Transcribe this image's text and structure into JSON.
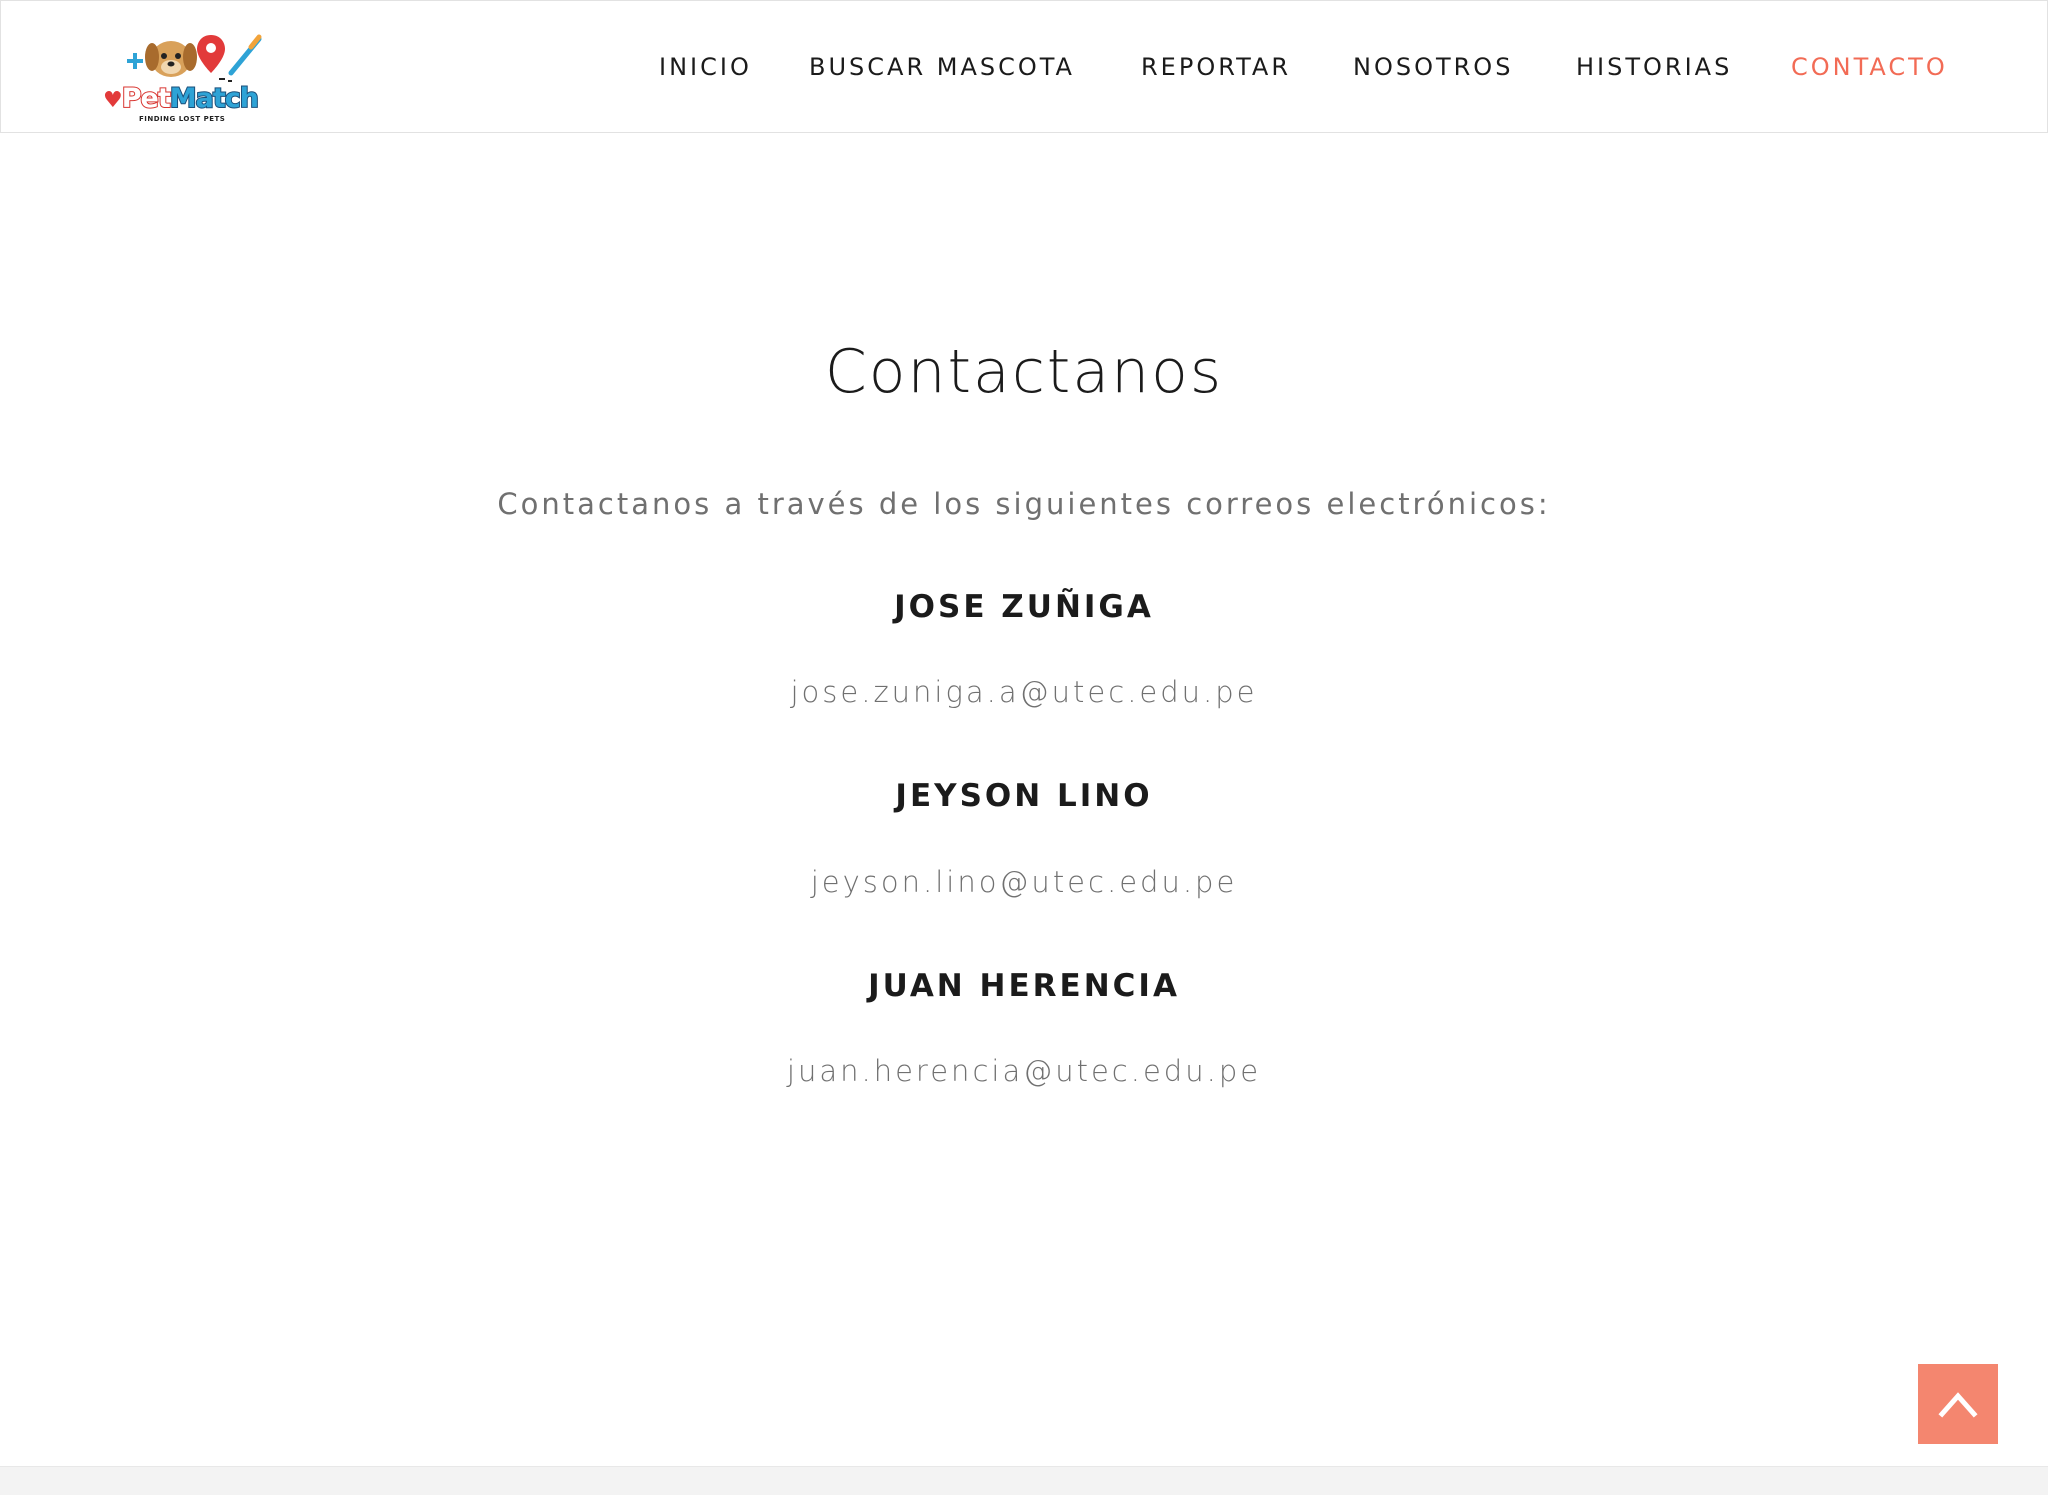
{
  "brand": {
    "name_part1": "Pet",
    "name_part2": "Match",
    "tagline": "FINDING LOST PETS"
  },
  "nav": {
    "items": [
      {
        "label": "INICIO"
      },
      {
        "label": "BUSCAR MASCOTA"
      },
      {
        "label": "REPORTAR"
      },
      {
        "label": "NOSOTROS"
      },
      {
        "label": "HISTORIAS"
      },
      {
        "label": "CONTACTO"
      }
    ],
    "active": "CONTACTO"
  },
  "main": {
    "title": "Contactanos",
    "subtitle": "Contactanos a través de los siguientes correos electrónicos:",
    "contacts": [
      {
        "name": "JOSE ZUÑIGA",
        "email": "jose.zuniga.a@utec.edu.pe"
      },
      {
        "name": "JEYSON LINO",
        "email": "jeyson.lino@utec.edu.pe"
      },
      {
        "name": "JUAN HERENCIA",
        "email": "juan.herencia@utec.edu.pe"
      }
    ]
  },
  "icons": {
    "scroll_top": "chevron-up-icon"
  },
  "colors": {
    "accent": "#f26b55",
    "scroll_button": "#f4866f",
    "text_dark": "#1b1b1b",
    "text_muted": "#707070"
  }
}
